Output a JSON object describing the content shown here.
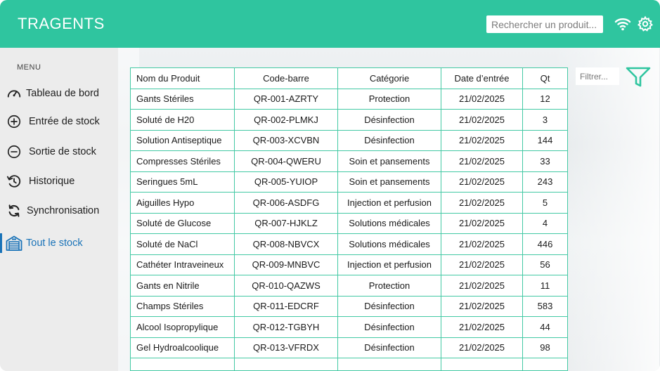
{
  "header": {
    "app_title": "TRAGENTS",
    "search_placeholder": "Rechercher un produit...",
    "icons": [
      "wifi-icon",
      "gear-icon"
    ]
  },
  "sidebar": {
    "menu_label": "MENU",
    "items": [
      {
        "label": "Tableau de bord",
        "icon": "gauge-icon"
      },
      {
        "label": "Entrée de stock",
        "icon": "plus-circle-icon"
      },
      {
        "label": "Sortie de stock",
        "icon": "minus-circle-icon"
      },
      {
        "label": "Historique",
        "icon": "history-icon"
      },
      {
        "label": "Synchronisation",
        "icon": "sync-icon"
      },
      {
        "label": "Tout le stock",
        "icon": "warehouse-icon",
        "active": true
      }
    ]
  },
  "filter": {
    "placeholder": "Filtrer...",
    "icon": "filter-icon"
  },
  "table": {
    "columns": [
      "Nom du Produit",
      "Code-barre",
      "Catégorie",
      "Date d’entrée",
      "Qt"
    ],
    "rows": [
      [
        "Gants Stériles",
        "QR-001-AZRTY",
        "Protection",
        "21/02/2025",
        "12"
      ],
      [
        "Soluté de H20",
        "QR-002-PLMKJ",
        "Désinfection",
        "21/02/2025",
        "3"
      ],
      [
        "Solution Antiseptique",
        "QR-003-XCVBN",
        "Désinfection",
        "21/02/2025",
        "144"
      ],
      [
        "Compresses Stériles",
        "QR-004-QWERU",
        "Soin et pansements",
        "21/02/2025",
        "33"
      ],
      [
        "Seringues 5mL",
        "QR-005-YUIOP",
        "Soin et pansements",
        "21/02/2025",
        "243"
      ],
      [
        "Aiguilles Hypo",
        "QR-006-ASDFG",
        "Injection et perfusion",
        "21/02/2025",
        "5"
      ],
      [
        "Soluté de Glucose",
        "QR-007-HJKLZ",
        "Solutions médicales",
        "21/02/2025",
        "4"
      ],
      [
        "Soluté de NaCl",
        "QR-008-NBVCX",
        "Solutions médicales",
        "21/02/2025",
        "446"
      ],
      [
        "Cathéter Intraveineux",
        "QR-009-MNBVC",
        "Injection et perfusion",
        "21/02/2025",
        "56"
      ],
      [
        "Gants en Nitrile",
        "QR-010-QAZWS",
        "Protection",
        "21/02/2025",
        "11"
      ],
      [
        "Champs Stériles",
        "QR-011-EDCRF",
        "Désinfection",
        "21/02/2025",
        "583"
      ],
      [
        "Alcool Isopropylique",
        "QR-012-TGBYH",
        "Désinfection",
        "21/02/2025",
        "44"
      ],
      [
        "Gel Hydroalcoolique",
        "QR-013-VFRDX",
        "Désinfection",
        "21/02/2025",
        "98"
      ]
    ]
  },
  "colors": {
    "header": "#2fc59f",
    "table_border": "#43c9a4",
    "active_nav": "#1a73b8",
    "sidebar_bg": "#ececec"
  }
}
